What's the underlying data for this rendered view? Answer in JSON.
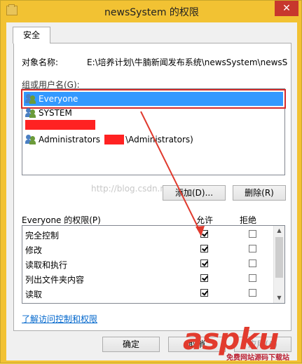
{
  "window": {
    "title": "newsSystem 的权限",
    "close_glyph": "✕"
  },
  "tabs": [
    {
      "label": "安全"
    }
  ],
  "object": {
    "label": "对象名称:",
    "value": "E:\\培养计划\\牛腩新闻发布系统\\newsSystem\\newsS"
  },
  "groups": {
    "label": "组或用户名(G):",
    "items": [
      {
        "name": "Everyone",
        "icon": "users-icon"
      },
      {
        "name": "SYSTEM",
        "icon": "users-icon"
      },
      {
        "name_prefix": "Administrators",
        "name_suffix": "\\Administrators)",
        "icon": "users-icon"
      }
    ]
  },
  "buttons": {
    "add": "添加(D)...",
    "remove": "删除(R)",
    "ok": "确定",
    "cancel": "取消",
    "apply": "应用(A)"
  },
  "permissions": {
    "header_name": "Everyone 的权限(P)",
    "header_allow": "允许",
    "header_deny": "拒绝",
    "rows": [
      {
        "name": "完全控制",
        "allow": true,
        "deny": false
      },
      {
        "name": "修改",
        "allow": true,
        "deny": false
      },
      {
        "name": "读取和执行",
        "allow": true,
        "deny": false
      },
      {
        "name": "列出文件夹内容",
        "allow": true,
        "deny": false
      },
      {
        "name": "读取",
        "allow": true,
        "deny": false
      }
    ]
  },
  "help_link": "了解访问控制和权限",
  "watermark": "http://blog.csdn.net/",
  "brand": {
    "text": "aspku",
    "sub": "免费网站源码下载站"
  },
  "colors": {
    "selection": "#3399ff",
    "highlight_box": "#d42a2a",
    "link": "#0066cc",
    "title_bar": "#f2c233"
  }
}
